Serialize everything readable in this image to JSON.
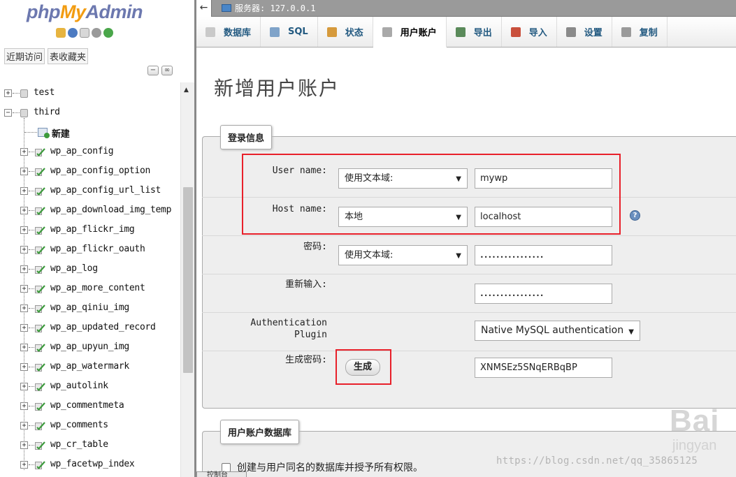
{
  "nav": {
    "logo": {
      "php": "php",
      "my": "My",
      "admin": "Admin"
    },
    "icons": [
      "home-icon",
      "logout-icon",
      "docs-icon",
      "settings-icon",
      "reload-icon"
    ],
    "links": [
      "近期访问",
      "表收藏夹"
    ],
    "tree": [
      {
        "label": "test",
        "level": 0,
        "expander": "+",
        "kind": "db"
      },
      {
        "label": "third",
        "level": 0,
        "expander": "−",
        "kind": "db"
      },
      {
        "label": "新建",
        "level": 1,
        "kind": "new"
      },
      {
        "label": "wp_ap_config",
        "level": 1,
        "expander": "+",
        "kind": "table"
      },
      {
        "label": "wp_ap_config_option",
        "level": 1,
        "expander": "+",
        "kind": "table"
      },
      {
        "label": "wp_ap_config_url_list",
        "level": 1,
        "expander": "+",
        "kind": "table"
      },
      {
        "label": "wp_ap_download_img_temp",
        "level": 1,
        "expander": "+",
        "kind": "table"
      },
      {
        "label": "wp_ap_flickr_img",
        "level": 1,
        "expander": "+",
        "kind": "table"
      },
      {
        "label": "wp_ap_flickr_oauth",
        "level": 1,
        "expander": "+",
        "kind": "table"
      },
      {
        "label": "wp_ap_log",
        "level": 1,
        "expander": "+",
        "kind": "table"
      },
      {
        "label": "wp_ap_more_content",
        "level": 1,
        "expander": "+",
        "kind": "table"
      },
      {
        "label": "wp_ap_qiniu_img",
        "level": 1,
        "expander": "+",
        "kind": "table"
      },
      {
        "label": "wp_ap_updated_record",
        "level": 1,
        "expander": "+",
        "kind": "table"
      },
      {
        "label": "wp_ap_upyun_img",
        "level": 1,
        "expander": "+",
        "kind": "table"
      },
      {
        "label": "wp_ap_watermark",
        "level": 1,
        "expander": "+",
        "kind": "table"
      },
      {
        "label": "wp_autolink",
        "level": 1,
        "expander": "+",
        "kind": "table"
      },
      {
        "label": "wp_commentmeta",
        "level": 1,
        "expander": "+",
        "kind": "table"
      },
      {
        "label": "wp_comments",
        "level": 1,
        "expander": "+",
        "kind": "table"
      },
      {
        "label": "wp_cr_table",
        "level": 1,
        "expander": "+",
        "kind": "table"
      },
      {
        "label": "wp_facetwp_index",
        "level": 1,
        "expander": "+",
        "kind": "table"
      }
    ]
  },
  "topbar": {
    "server": "服务器: 127.0.0.1"
  },
  "tabs": [
    {
      "label": "数据库",
      "icon": "database-icon",
      "color": "#c9c9c9"
    },
    {
      "label": "SQL",
      "icon": "sql-icon",
      "color": "#7fa3c9"
    },
    {
      "label": "状态",
      "icon": "status-icon",
      "color": "#d69a3c"
    },
    {
      "label": "用户账户",
      "icon": "users-icon",
      "color": "#a9a9a9",
      "active": true
    },
    {
      "label": "导出",
      "icon": "export-icon",
      "color": "#5a8a5a"
    },
    {
      "label": "导入",
      "icon": "import-icon",
      "color": "#c9503c"
    },
    {
      "label": "设置",
      "icon": "wrench-icon",
      "color": "#8a8a8a"
    },
    {
      "label": "复制",
      "icon": "replicate-icon",
      "color": "#9a9a9a"
    }
  ],
  "page": {
    "title": "新增用户账户",
    "login_legend": "登录信息",
    "db_legend": "用户账户数据库",
    "fields": {
      "username": {
        "label": "User name:",
        "select": "使用文本域:",
        "value": "mywp"
      },
      "hostname": {
        "label": "Host name:",
        "select": "本地",
        "value": "localhost"
      },
      "password": {
        "label": "密码:",
        "select": "使用文本域:",
        "value": "••••••••••••••••"
      },
      "retype": {
        "label": "重新输入:",
        "value": "••••••••••••••••"
      },
      "auth": {
        "label_line1": "Authentication",
        "label_line2": "Plugin",
        "value": "Native MySQL authentication"
      },
      "generate": {
        "label": "生成密码:",
        "button": "生成",
        "value": "XNMSEz5SNqERBqBP"
      }
    },
    "create_db_label": "创建与用户同名的数据库并授予所有权限。",
    "console_label": "控制台"
  },
  "watermark": {
    "url": "https://blog.csdn.net/qq_35865125",
    "logo": "Bai",
    "sub": "jingyan"
  },
  "colors": {
    "highlight": "#e8202a",
    "tab_text": "#235a81",
    "logo_php": "#6c78af",
    "logo_my": "#f29c11"
  }
}
